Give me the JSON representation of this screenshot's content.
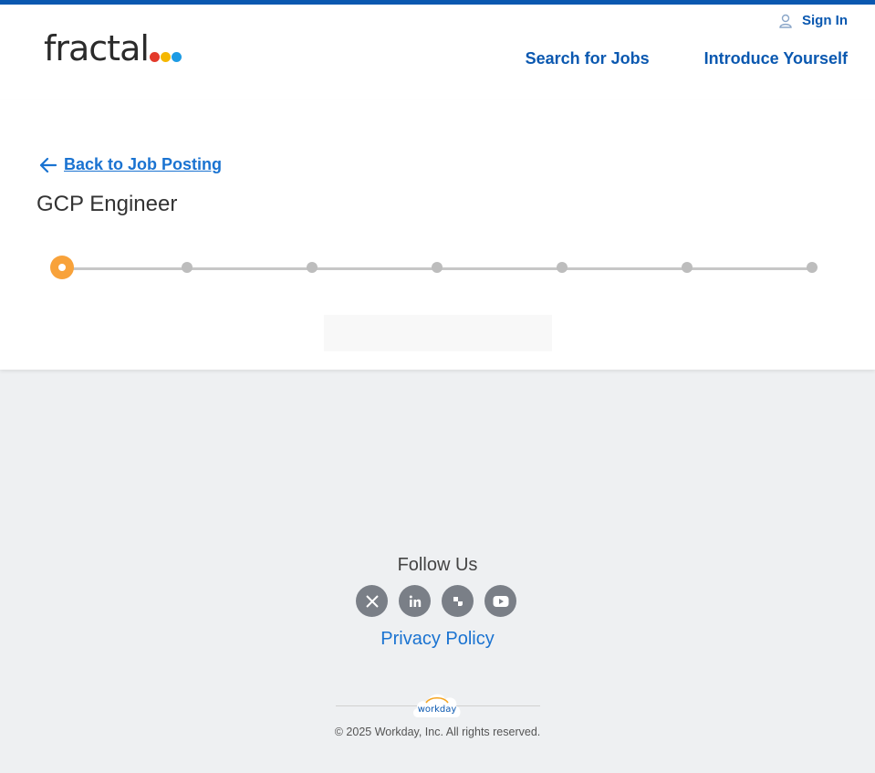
{
  "header": {
    "logo_text": "fractal",
    "logo_dot_colors": [
      "#e33a2b",
      "#f5b700",
      "#1e9be4"
    ],
    "sign_in": "Sign In",
    "nav": [
      "Search for Jobs",
      "Introduce Yourself"
    ]
  },
  "page": {
    "back_link": "Back to Job Posting",
    "job_title": "GCP Engineer",
    "progress": {
      "current_step": 1,
      "total_steps": 7
    }
  },
  "footer": {
    "follow_us": "Follow Us",
    "social_icons": [
      "x-icon",
      "linkedin-icon",
      "glassdoor-icon",
      "youtube-icon"
    ],
    "privacy_policy": "Privacy Policy",
    "workday_logo_text": "workday",
    "copyright": "© 2025 Workday, Inc. All rights reserved."
  },
  "colors": {
    "brand_blue": "#0a58b0",
    "link_blue": "#1a73d1",
    "active_step": "#f8a23a"
  }
}
